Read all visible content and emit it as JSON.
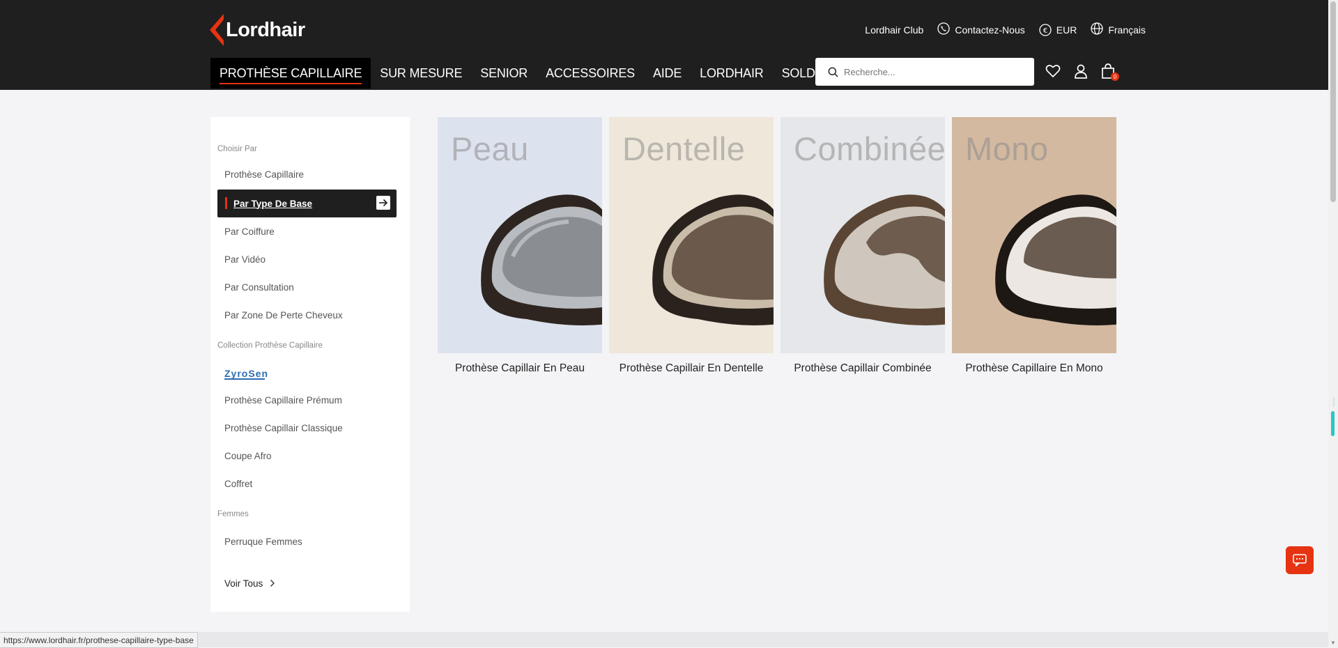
{
  "brand": {
    "name": "Lordhair",
    "accent": "#e63312"
  },
  "utility": {
    "club": "Lordhair Club",
    "contact": "Contactez-Nous",
    "currency": "EUR",
    "currency_symbol": "€",
    "language": "Français"
  },
  "nav": [
    {
      "label": "PROTHÈSE CAPILLAIRE",
      "active": true
    },
    {
      "label": "SUR MESURE"
    },
    {
      "label": "SENIOR"
    },
    {
      "label": "ACCESSOIRES"
    },
    {
      "label": "AIDE"
    },
    {
      "label": "LORDHAIR"
    },
    {
      "label": "SOLDE"
    }
  ],
  "search": {
    "placeholder": "Recherche..."
  },
  "cart": {
    "count": "0"
  },
  "sidebar": {
    "section1": "Choisir Par",
    "items1": [
      "Prothèse Capillaire",
      "Par Type De Base",
      "Par Coiffure",
      "Par Vidéo",
      "Par Consultation",
      "Par Zone De Perte Cheveux"
    ],
    "section2": "Collection Prothèse Capillaire",
    "zyrosen": "ZyroSen",
    "items2": [
      "Prothèse Capillaire Prémum",
      "Prothèse Capillair Classique",
      "Coupe Afro",
      "Coffret"
    ],
    "section3": "Femmes",
    "items3": [
      "Perruque Femmes"
    ],
    "see_all": "Voir Tous"
  },
  "cards": [
    {
      "title": "Peau",
      "caption": "Prothèse Capillair En Peau",
      "bg": "#dde3ee"
    },
    {
      "title": "Dentelle",
      "caption": "Prothèse Capillair En Dentelle",
      "bg": "#efe7da"
    },
    {
      "title": "Combinée",
      "caption": "Prothèse Capillair Combinée",
      "bg": "#e6e7ea"
    },
    {
      "title": "Mono",
      "caption": "Prothèse Capillaire En Mono",
      "bg": "#d3b9a0"
    }
  ],
  "status_url": "https://www.lordhair.fr/prothese-capillaire-type-base"
}
